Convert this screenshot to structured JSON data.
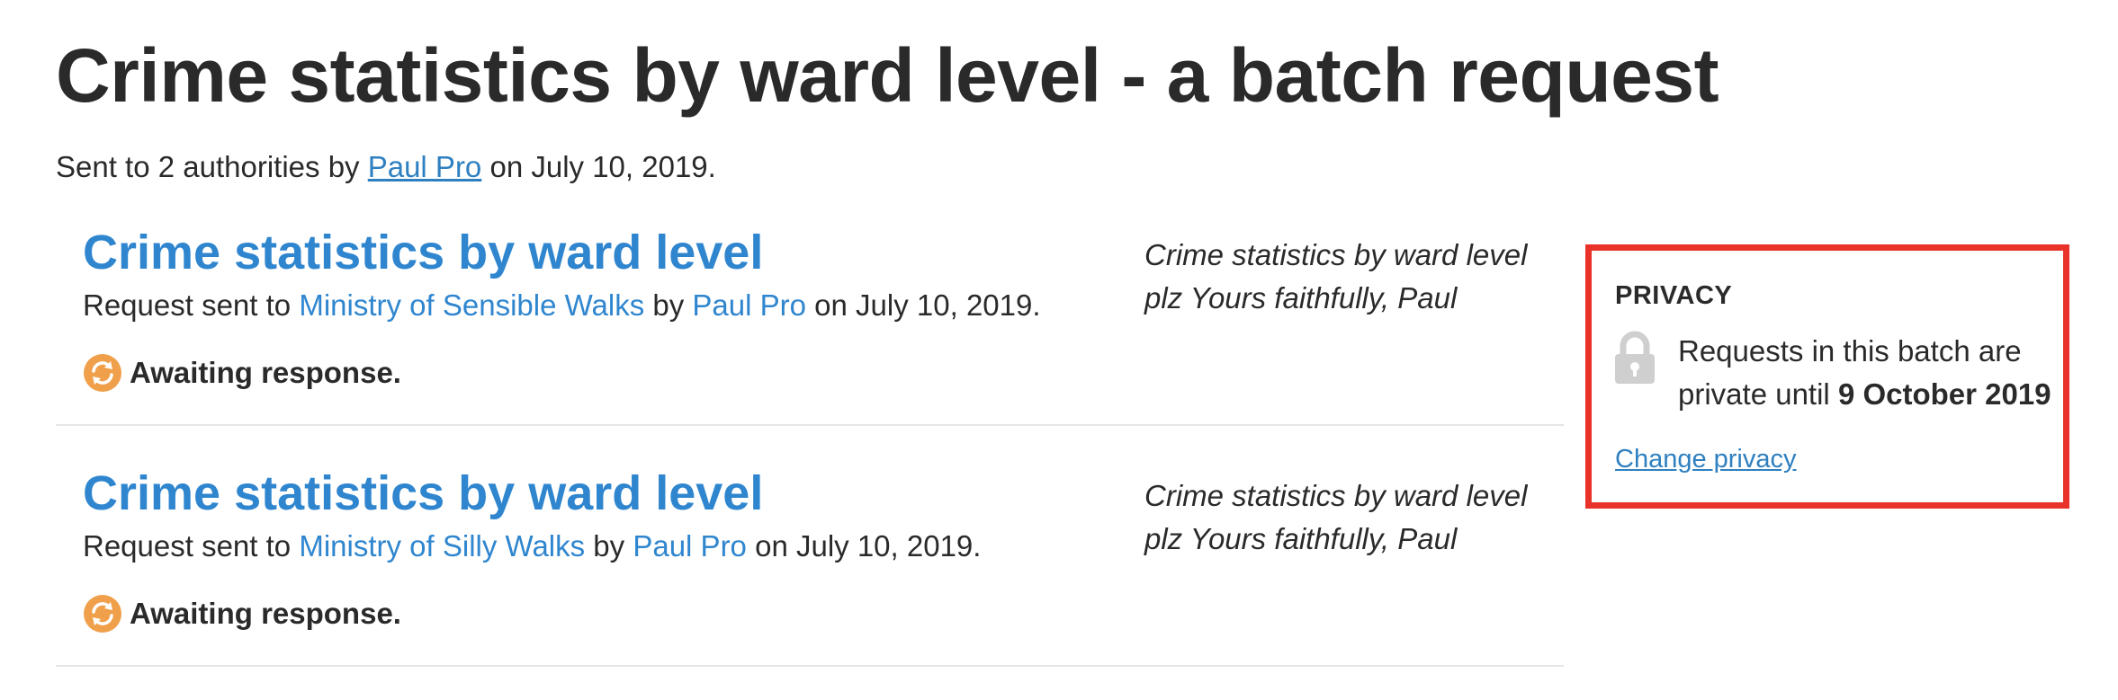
{
  "page": {
    "title": "Crime statistics by ward level - a batch request"
  },
  "batch": {
    "sent_prefix": "Sent to 2 authorities by ",
    "author": "Paul Pro",
    "sent_suffix": " on July 10, 2019."
  },
  "requests": [
    {
      "title": "Crime statistics by ward level",
      "sent_prefix": "Request sent to ",
      "authority": "Ministry of Sensible Walks",
      "by": " by ",
      "author": "Paul Pro",
      "date_text": " on July 10, 2019.",
      "status": "Awaiting response.",
      "excerpt": "Crime statistics by ward level plz Yours faithfully, Paul"
    },
    {
      "title": "Crime statistics by ward level",
      "sent_prefix": "Request sent to ",
      "authority": "Ministry of Silly Walks",
      "by": " by ",
      "author": "Paul Pro",
      "date_text": " on July 10, 2019.",
      "status": "Awaiting response.",
      "excerpt": "Crime statistics by ward level plz Yours faithfully, Paul"
    }
  ],
  "privacy": {
    "heading": "PRIVACY",
    "text_prefix": "Requests in this batch are private until ",
    "private_until": "9 October 2019",
    "change_label": "Change privacy",
    "icon": "lock-icon"
  },
  "icons": {
    "status_icon": "refresh-icon"
  },
  "colors": {
    "link": "#2f86cf",
    "status_orange": "#f0a04b",
    "highlight_border": "#e8322a",
    "lock_gray": "#cfcfcf"
  }
}
